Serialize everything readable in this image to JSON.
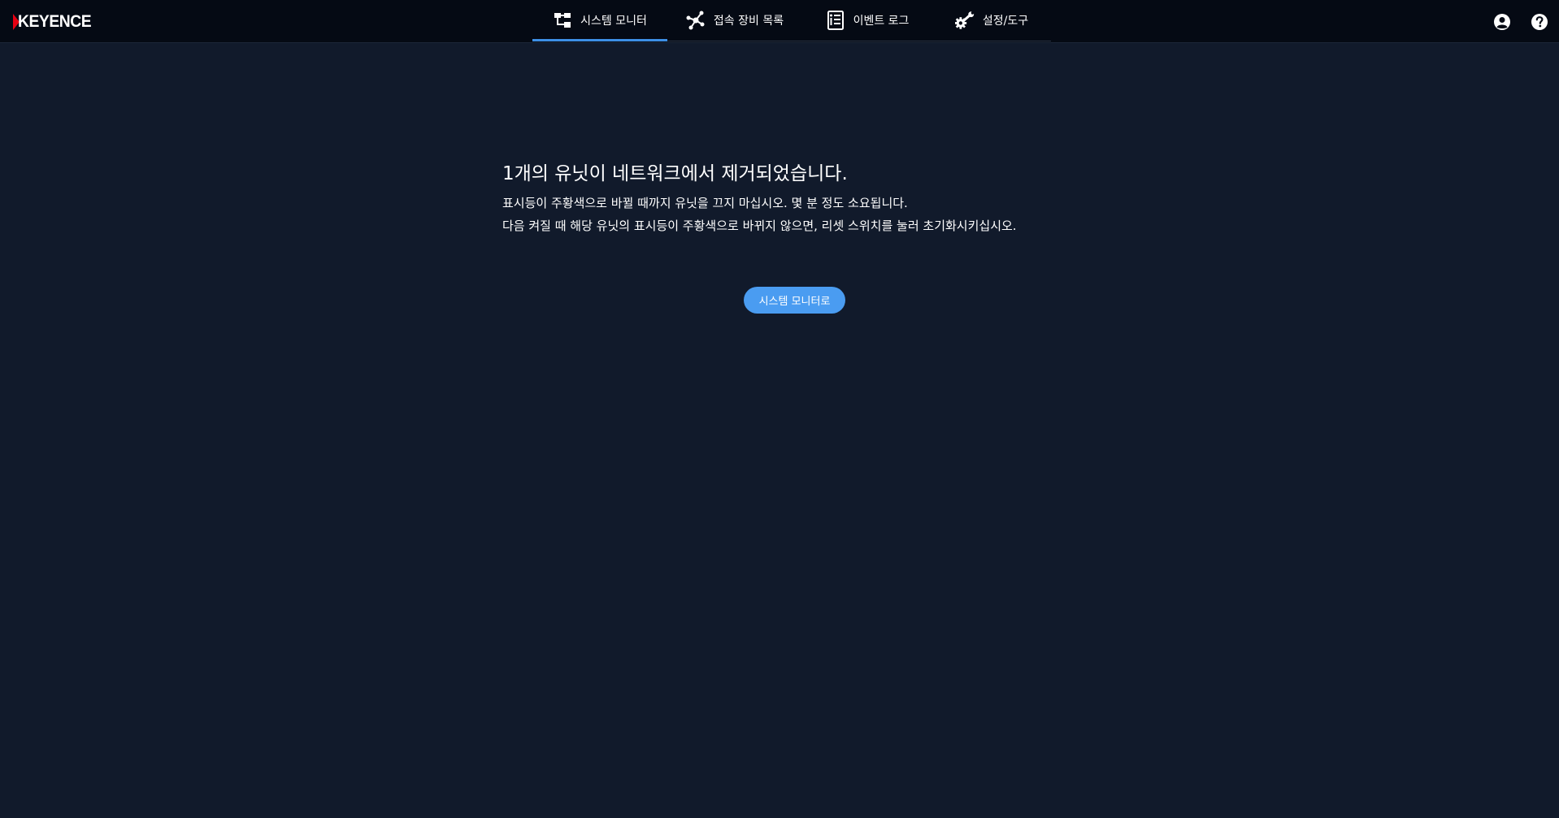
{
  "header": {
    "logo_text": "KEYENCE",
    "brand_color": "#e60012",
    "accent_color": "#3d8fe5",
    "tabs": [
      {
        "label": "시스템 모니터",
        "icon": "hierarchy-icon",
        "active": true
      },
      {
        "label": "접속 장비 목록",
        "icon": "network-nodes-icon",
        "active": false
      },
      {
        "label": "이벤트 로그",
        "icon": "event-log-icon",
        "active": false
      },
      {
        "label": "설정/도구",
        "icon": "gear-wrench-icon",
        "active": false
      }
    ],
    "right_icons": [
      "user-account-icon",
      "help-icon"
    ]
  },
  "message": {
    "title": "1개의 유닛이 네트워크에서 제거되었습니다.",
    "line1": "표시등이 주황색으로 바뀔 때까지 유닛을 끄지 마십시오. 몇 분 정도 소요됩니다.",
    "line2": "다음 켜질 때 해당 유닛의 표시등이 주황색으로 바뀌지 않으면, 리셋 스위치를 눌러 초기화시키십시오."
  },
  "action": {
    "button_label": "시스템 모니터로",
    "button_color": "#4a9cf1"
  }
}
